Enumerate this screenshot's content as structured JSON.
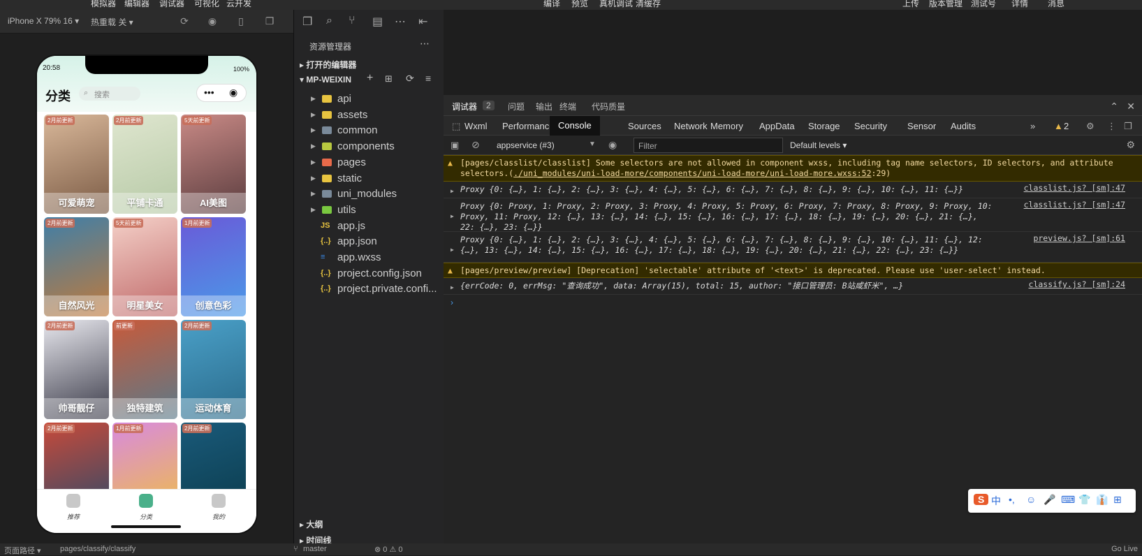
{
  "menubar": {
    "items": [
      "模拟器",
      "编辑器",
      "调试器",
      "可视化",
      "云开发",
      "编译",
      "预览",
      "真机调试",
      "清缓存",
      "上传",
      "版本管理",
      "测试号",
      "详情",
      "消息"
    ]
  },
  "simulator_bar": {
    "device": "iPhone X 79% 16 ▾",
    "hot_reload": "热重载 关 ▾"
  },
  "phone": {
    "time": "20:58",
    "battery": "100%",
    "title": "分类",
    "search_placeholder": "搜索",
    "cards": [
      {
        "tag": "2月前更新",
        "label": "可爱萌宠",
        "c1": "#d9b89a",
        "c2": "#7a5a44"
      },
      {
        "tag": "2月前更新",
        "label": "平铺卡通",
        "c1": "#dfe6cf",
        "c2": "#b6c9a6"
      },
      {
        "tag": "5天前更新",
        "label": "AI美图",
        "c1": "#c98a86",
        "c2": "#5a3c3e"
      },
      {
        "tag": "2月前更新",
        "label": "自然风光",
        "c1": "#3f7fa8",
        "c2": "#c07a3c"
      },
      {
        "tag": "5天前更新",
        "label": "明星美女",
        "c1": "#f4d0c8",
        "c2": "#c06a6a"
      },
      {
        "tag": "1月前更新",
        "label": "创意色彩",
        "c1": "#6a5ad8",
        "c2": "#4a9ae8"
      },
      {
        "tag": "2月前更新",
        "label": "帅哥靓仔",
        "c1": "#e8e8ee",
        "c2": "#3a3a48"
      },
      {
        "tag": "前更新",
        "label": "独特建筑",
        "c1": "#c85a3a",
        "c2": "#5a7a8a"
      },
      {
        "tag": "2月前更新",
        "label": "运动体育",
        "c1": "#4aa0c8",
        "c2": "#2a6a8a"
      },
      {
        "tag": "2月前更新",
        "label": "",
        "c1": "#c84a3a",
        "c2": "#2a4a6a"
      },
      {
        "tag": "1月前更新",
        "label": "",
        "c1": "#d88adf",
        "c2": "#f0c040"
      },
      {
        "tag": "2月前更新",
        "label": "",
        "c1": "#1a5a7a",
        "c2": "#0a3a4a"
      }
    ],
    "tabs": [
      "推荐",
      "分类",
      "我的"
    ]
  },
  "status_bar": {
    "path_label": "页面路径 ▾",
    "path": "pages/classify/classify",
    "branch": "master",
    "errors": "⊗ 0 ⚠ 0",
    "golive": "Go Live"
  },
  "explorer": {
    "title": "资源管理器",
    "open_editors": "打开的编辑器",
    "project": "MP-WEIXIN",
    "items": [
      {
        "name": "api",
        "type": "folder",
        "color": "#e8c440"
      },
      {
        "name": "assets",
        "type": "folder",
        "color": "#e8c440"
      },
      {
        "name": "common",
        "type": "folder",
        "color": "#7a8a9a"
      },
      {
        "name": "components",
        "type": "folder",
        "color": "#b8c840"
      },
      {
        "name": "pages",
        "type": "folder",
        "color": "#e86a4a"
      },
      {
        "name": "static",
        "type": "folder",
        "color": "#e8c440"
      },
      {
        "name": "uni_modules",
        "type": "folder",
        "color": "#7a8a9a"
      },
      {
        "name": "utils",
        "type": "folder",
        "color": "#7ac840"
      },
      {
        "name": "app.js",
        "type": "js",
        "color": "#e8c440"
      },
      {
        "name": "app.json",
        "type": "json",
        "color": "#e8c440"
      },
      {
        "name": "app.wxss",
        "type": "css",
        "color": "#3a8ae8"
      },
      {
        "name": "project.config.json",
        "type": "json",
        "color": "#e8c440"
      },
      {
        "name": "project.private.confi...",
        "type": "json",
        "color": "#e8c440"
      }
    ],
    "outline": "大纲",
    "timeline": "时间线"
  },
  "devtools": {
    "top_tabs": [
      "调试器",
      "2",
      "问题",
      "输出",
      "终端",
      "代码质量"
    ],
    "tabs": [
      "Wxml",
      "Performance",
      "Console",
      "Sources",
      "Network",
      "Memory",
      "AppData",
      "Storage",
      "Security",
      "Sensor",
      "Audits"
    ],
    "warn_count": "2",
    "context": "appservice (#3)",
    "filter_placeholder": "Filter",
    "levels": "Default levels ▾",
    "logs": [
      {
        "kind": "warn",
        "text": "[pages/classlist/classlist] Some selectors are not allowed in component wxss, including tag name selectors, ID selectors, and attribute selectors.(",
        "link": "./uni_modules/uni-load-more/components/uni-load-more/uni-load-more.wxss:52",
        "tail": ":29)"
      },
      {
        "kind": "log",
        "text": "Proxy {0: {…}, 1: {…}, 2: {…}, 3: {…}, 4: {…}, 5: {…}, 6: {…}, 7: {…}, 8: {…}, 9: {…}, 10: {…}, 11: {…}}",
        "src": "classlist.js? [sm]:47"
      },
      {
        "kind": "log",
        "text": "Proxy {0: Proxy, 1: Proxy, 2: Proxy, 3: Proxy, 4: Proxy, 5: Proxy, 6: Proxy, 7: Proxy, 8: Proxy, 9: Proxy, 10: Proxy, 11: Proxy, 12: {…}, 13: {…}, 14: {…}, 15: {…}, 16: {…}, 17: {…}, 18: {…}, 19: {…}, 20: {…}, 21: {…}, 22: {…}, 23: {…}}",
        "src": "classlist.js? [sm]:47"
      },
      {
        "kind": "log",
        "text": "Proxy {0: {…}, 1: {…}, 2: {…}, 3: {…}, 4: {…}, 5: {…}, 6: {…}, 7: {…}, 8: {…}, 9: {…}, 10: {…}, 11: {…}, 12: {…}, 13: {…}, 14: {…}, 15: {…}, 16: {…}, 17: {…}, 18: {…}, 19: {…}, 20: {…}, 21: {…}, 22: {…}, 23: {…}}",
        "src": "preview.js? [sm]:61"
      },
      {
        "kind": "warn",
        "text": "[pages/preview/preview] [Deprecation] 'selectable' attribute of '<text>' is deprecated. Please use 'user-select' instead."
      },
      {
        "kind": "log",
        "text": "{errCode: 0, errMsg: \"查询成功\", data: Array(15), total: 15, author: \"接口管理员: B站咸虾米\", …}",
        "src": "classify.js? [sm]:24"
      }
    ],
    "prompt": "›"
  },
  "ime": {
    "items": [
      "S",
      "中",
      "•,",
      "☺",
      "🎤",
      "⌨",
      "👕",
      "👔",
      "⊞"
    ]
  }
}
